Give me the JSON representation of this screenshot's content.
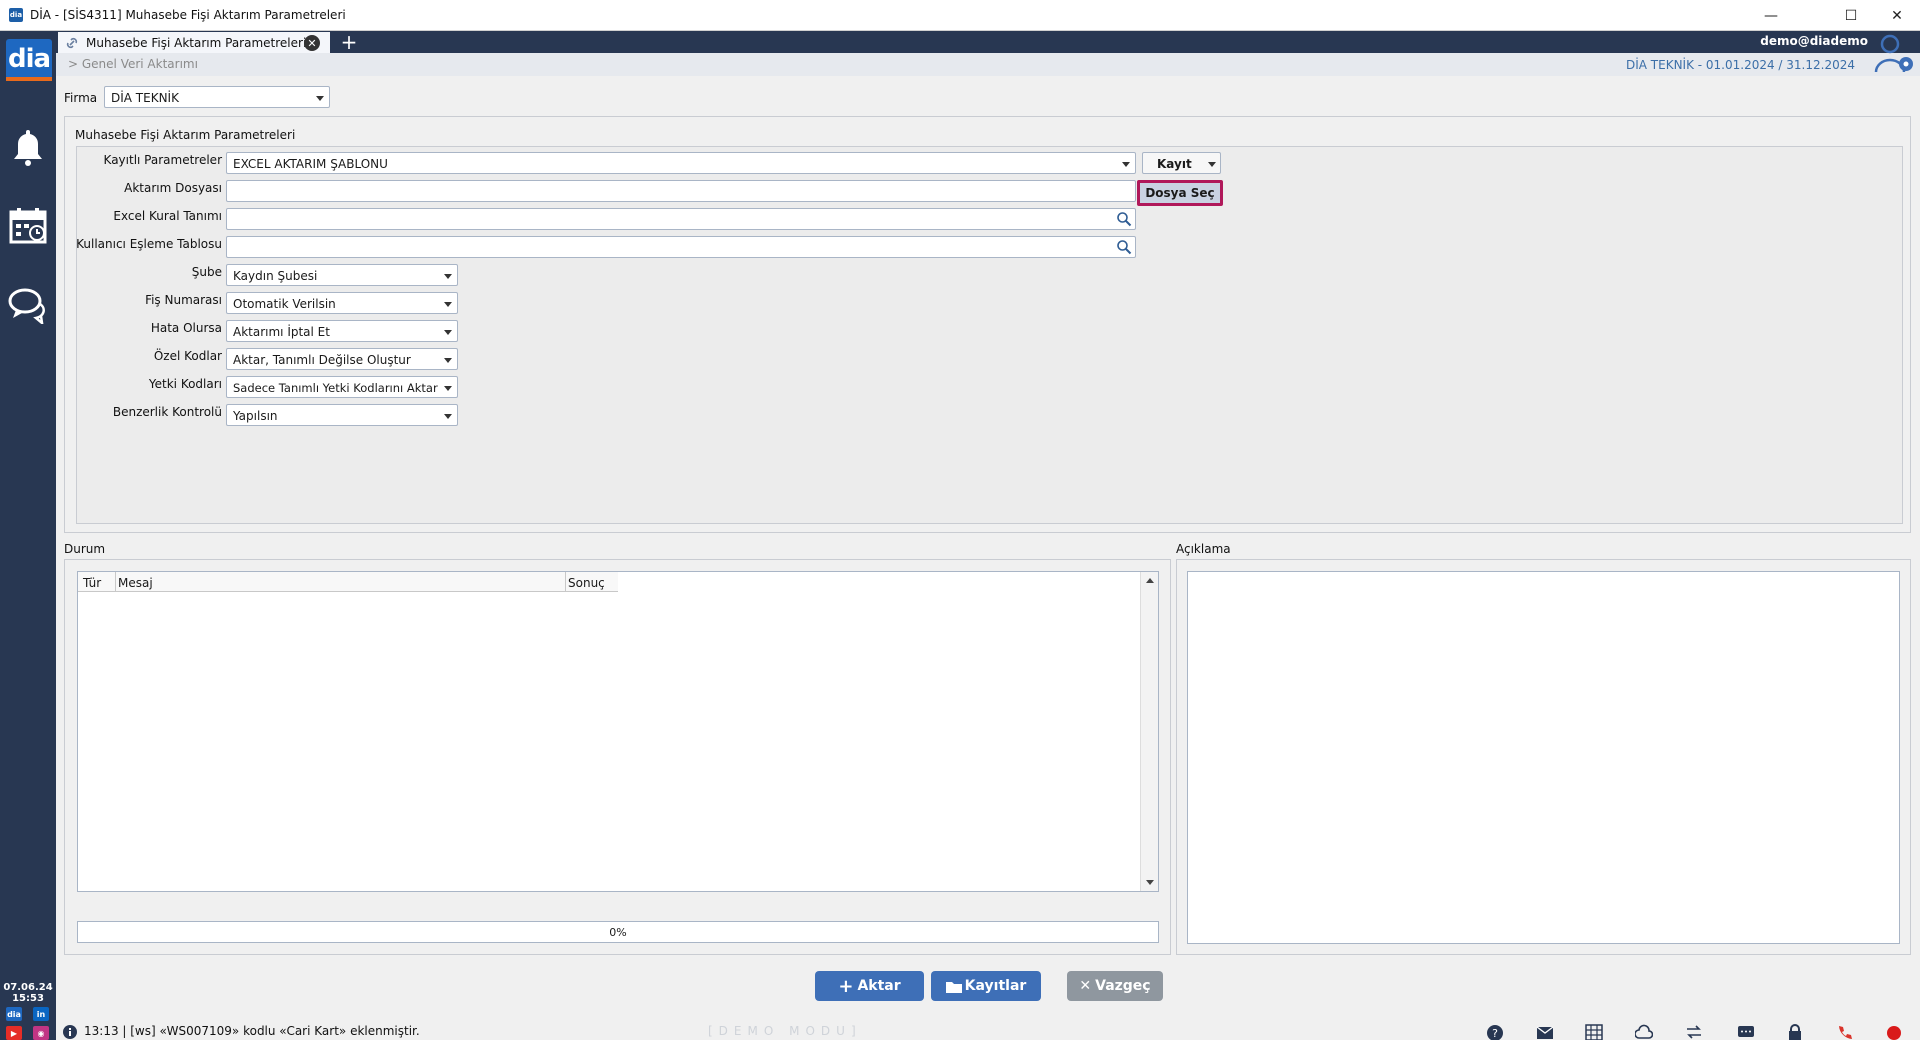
{
  "window": {
    "title": "DİA - [SİS4311] Muhasebe Fişi Aktarım Parametreleri",
    "app_icon": "dia",
    "controls": [
      "minimize",
      "maximize",
      "close"
    ]
  },
  "sidebar": {
    "logo": "dia",
    "items": [
      "bell-icon",
      "calendar-icon",
      "chat-icon"
    ],
    "date": "07.06.24",
    "time": "15:53",
    "social": [
      "dia",
      "in"
    ]
  },
  "tabbar": {
    "tab_label": "Muhasebe Fişi Aktarım Parametreleri",
    "user": "demo@diademo"
  },
  "crumb": {
    "path": "> Genel Veri Aktarımı",
    "company_period": "DİA TEKNİK -  01.01.2024 / 31.12.2024"
  },
  "firma": {
    "label": "Firma",
    "value": "DİA TEKNİK"
  },
  "params": {
    "title": "Muhasebe Fişi Aktarım Parametreleri",
    "kayitli_label": "Kayıtlı Parametreler",
    "kayitli_value": "EXCEL AKTARIM ŞABLONU",
    "kayit_button": "Kayıt",
    "aktarim_label": "Aktarım Dosyası",
    "aktarim_value": "",
    "dosya_button": "Dosya Seç",
    "excel_label": "Excel Kural Tanımı",
    "excel_value": "",
    "kullanici_label": "Kullanıcı Eşleme Tablosu",
    "kullanici_value": "",
    "sube_label": "Şube",
    "sube_value": "Kaydın Şubesi",
    "fis_label": "Fiş Numarası",
    "fis_value": "Otomatik Verilsin",
    "hata_label": "Hata Olursa",
    "hata_value": "Aktarımı İptal Et",
    "ozel_label": "Özel Kodlar",
    "ozel_value": "Aktar, Tanımlı Değilse Oluştur",
    "yetki_label": "Yetki Kodları",
    "yetki_value": "Sadece Tanımlı Yetki Kodlarını Aktar",
    "benzerlik_label": "Benzerlik Kontrolü",
    "benzerlik_value": "Yapılsın"
  },
  "durum": {
    "title": "Durum",
    "columns": [
      "Tür",
      "Mesaj",
      "Sonuç"
    ],
    "rows": [],
    "progress_text": "0%",
    "progress": 0
  },
  "aciklama": {
    "title": "Açıklama"
  },
  "actions": {
    "aktar": "Aktar",
    "kayitlar": "Kayıtlar",
    "vazgec": "Vazgeç"
  },
  "status": {
    "message": "13:13 | [ws] «WS007109» kodlu «Cari Kart» eklenmiştir.",
    "mode": "[DEMO MODU]"
  },
  "colors": {
    "sidebar": "#283752",
    "accent": "#3e6fb7",
    "highlight_border": "#b0185a",
    "vazgec": "#8f979f"
  }
}
